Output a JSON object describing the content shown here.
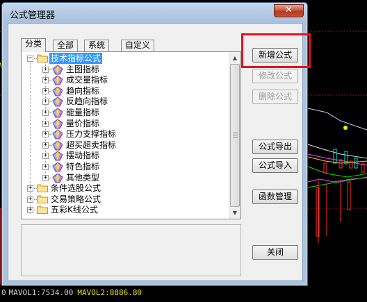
{
  "window": {
    "title": "公式管理器",
    "close_glyph": "✕"
  },
  "tabs": [
    {
      "label": "分类",
      "active": true
    },
    {
      "label": "全部",
      "active": false
    },
    {
      "label": "系统",
      "active": false
    },
    {
      "label": "自定义",
      "active": false
    }
  ],
  "tree": {
    "root": {
      "label": "技术指标公式",
      "expanded": true,
      "selected": true,
      "icon": "folder-icon"
    },
    "children": [
      {
        "label": "主图指标",
        "icon": "gem-icon"
      },
      {
        "label": "成交量指标",
        "icon": "gem-icon"
      },
      {
        "label": "趋向指标",
        "icon": "gem-icon"
      },
      {
        "label": "反趋向指标",
        "icon": "gem-icon"
      },
      {
        "label": "能量指标",
        "icon": "gem-icon"
      },
      {
        "label": "量价指标",
        "icon": "gem-icon"
      },
      {
        "label": "压力支撑指标",
        "icon": "gem-icon"
      },
      {
        "label": "超买超卖指标",
        "icon": "gem-icon"
      },
      {
        "label": "摆动指标",
        "icon": "gem-icon"
      },
      {
        "label": "特色指标",
        "icon": "gem-icon"
      },
      {
        "label": "其他类型",
        "icon": "gem-icon"
      }
    ],
    "siblings": [
      {
        "label": "条件选股公式",
        "icon": "folder-icon"
      },
      {
        "label": "交易策略公式",
        "icon": "folder-icon"
      },
      {
        "label": "五彩K线公式",
        "icon": "folder-icon"
      }
    ],
    "expanded_glyph": "−",
    "collapsed_glyph": "+"
  },
  "buttons": {
    "new_formula": "新增公式",
    "modify_formula": "修改公式",
    "delete_formula": "删除公式",
    "export_formula": "公式导出",
    "import_formula": "公式导入",
    "function_manage": "函数管理",
    "close": "关闭"
  },
  "status_bar": {
    "prefix": "0",
    "mavol1": "MAVOL1:7534.00",
    "mavol2": "MAVOL2:8886.80"
  },
  "colors": {
    "highlight": "#e8111a",
    "selection": "#3399ff",
    "mavol2": "#e8e000"
  }
}
